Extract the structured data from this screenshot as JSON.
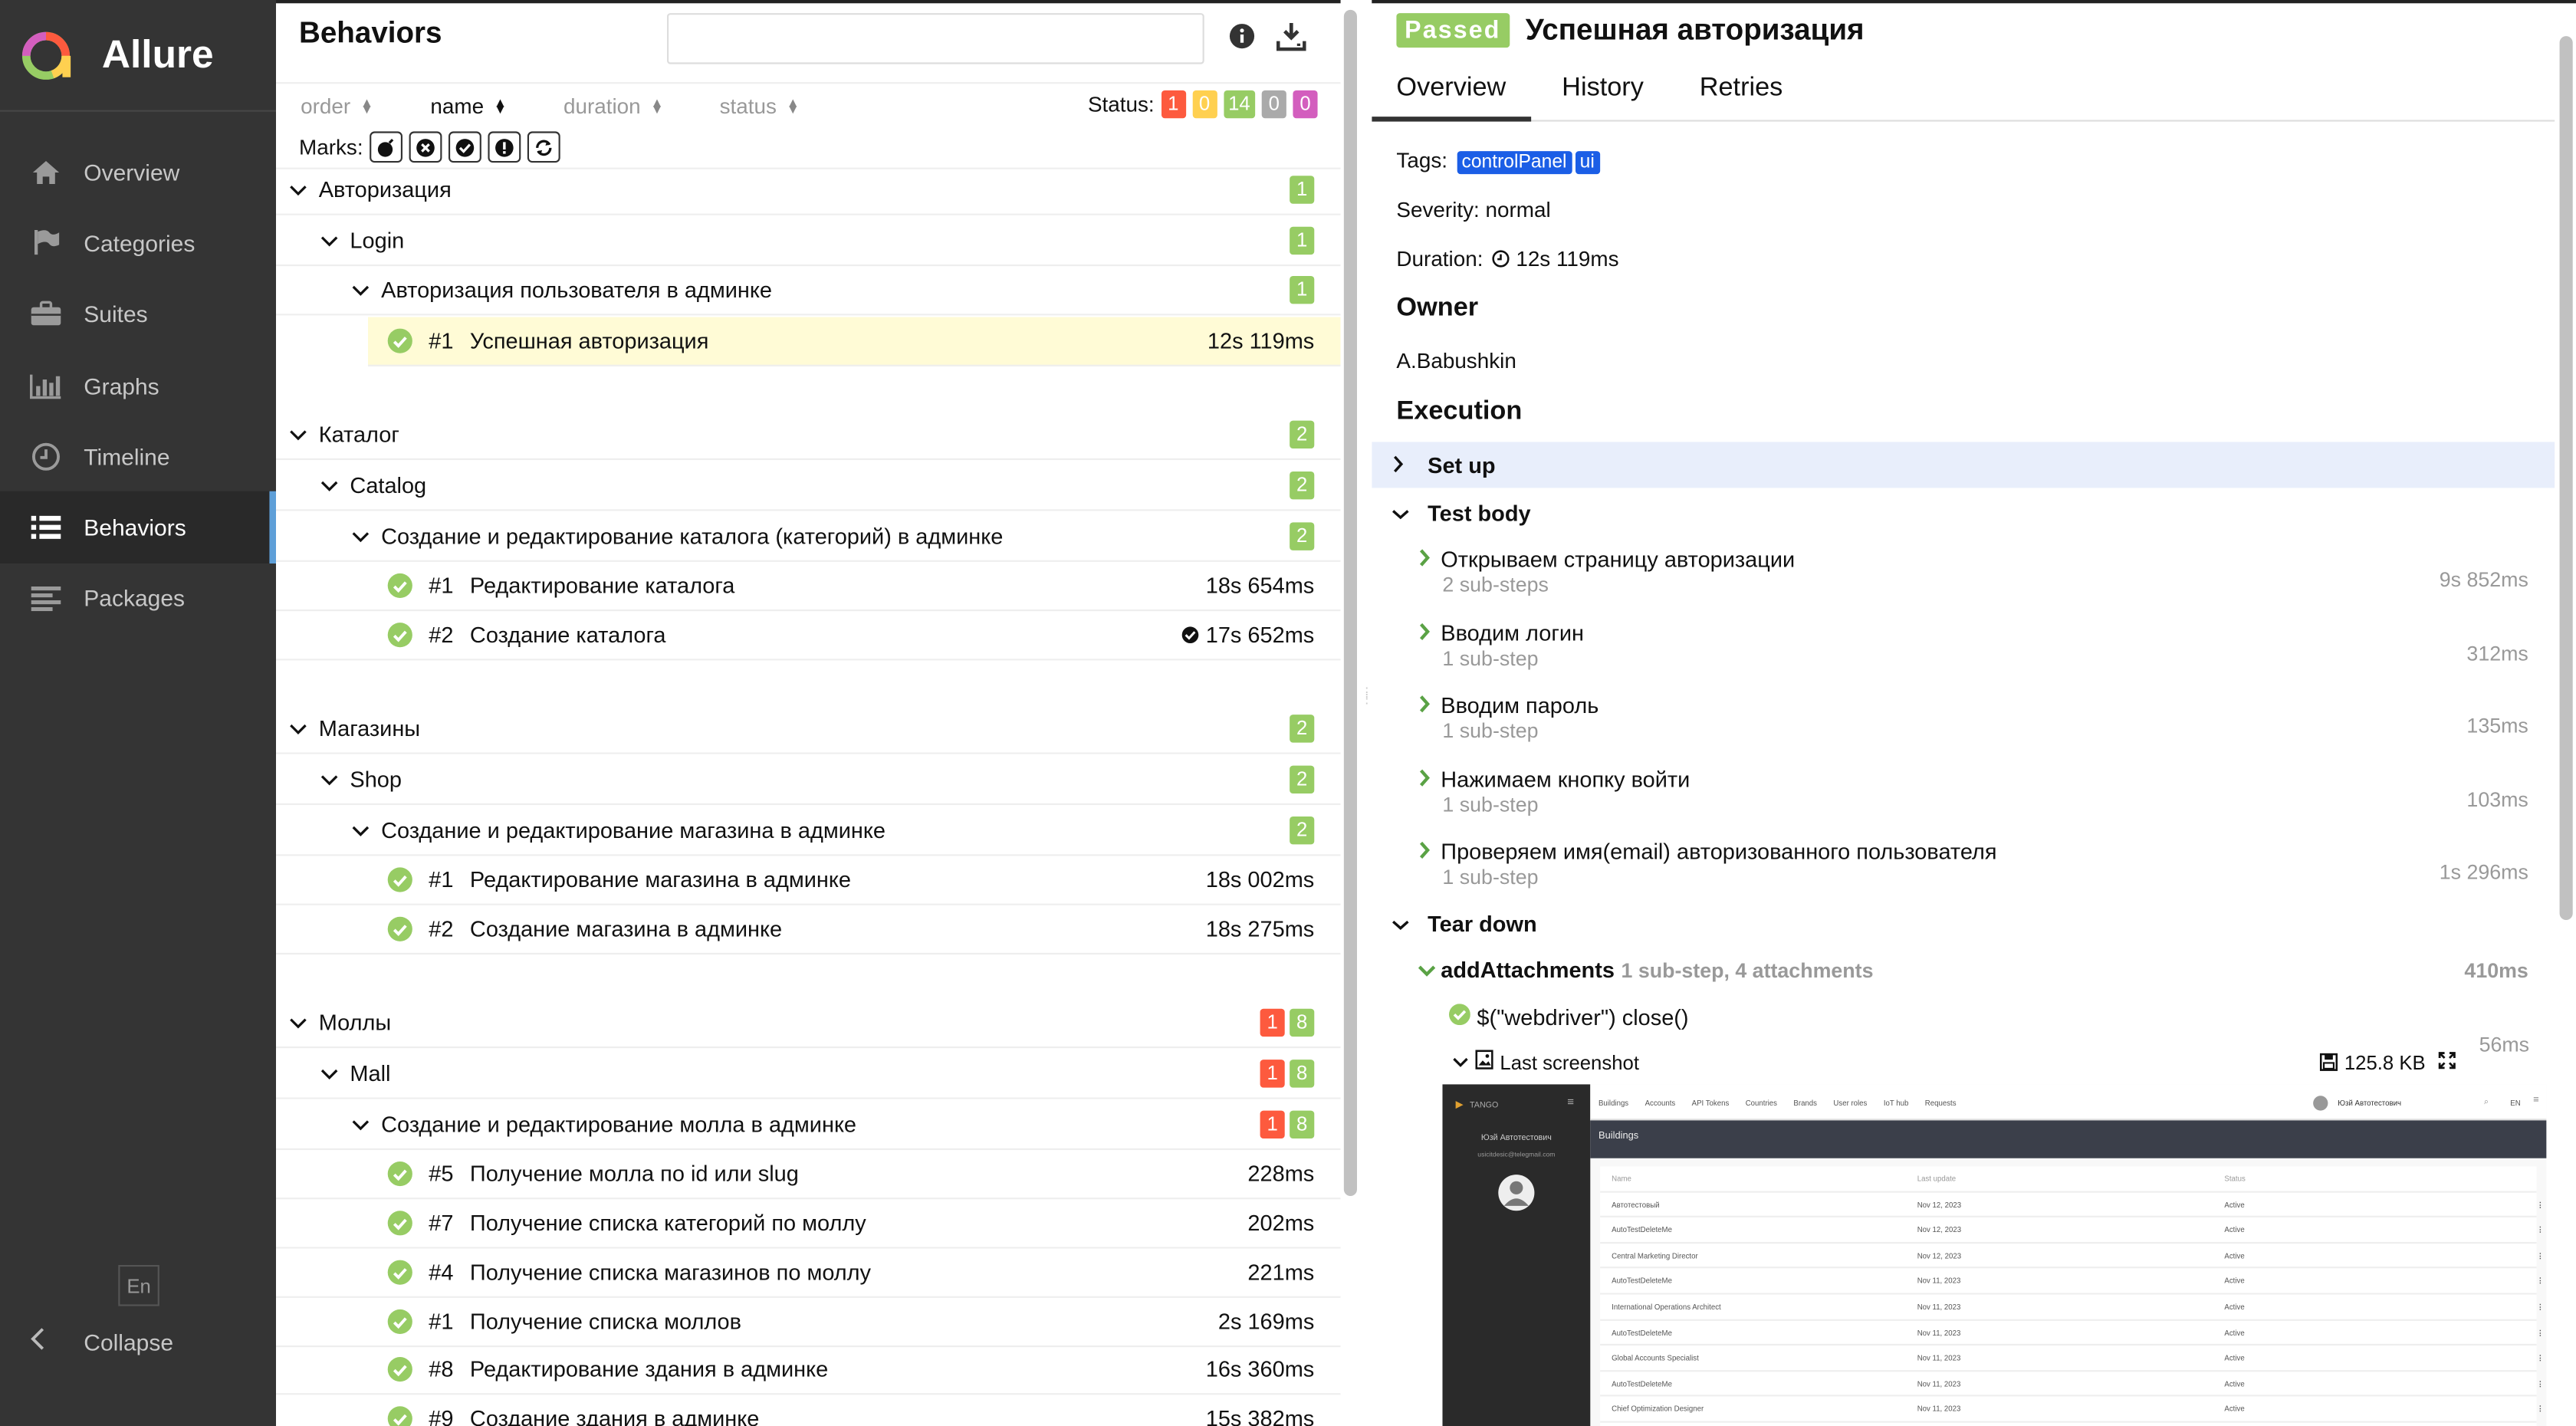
{
  "sidebar": {
    "brand": "Allure",
    "items": [
      {
        "label": "Overview",
        "icon": "home-icon"
      },
      {
        "label": "Categories",
        "icon": "flag-icon"
      },
      {
        "label": "Suites",
        "icon": "briefcase-icon"
      },
      {
        "label": "Graphs",
        "icon": "bar-chart-icon"
      },
      {
        "label": "Timeline",
        "icon": "clock-icon"
      },
      {
        "label": "Behaviors",
        "icon": "list-icon",
        "active": true
      },
      {
        "label": "Packages",
        "icon": "align-left-icon"
      }
    ],
    "lang": "En",
    "collapse": "Collapse"
  },
  "tree": {
    "title": "Behaviors",
    "search_value": "",
    "sort": {
      "order": "order",
      "name": "name",
      "duration": "duration",
      "status": "status"
    },
    "status_label": "Status:",
    "status_counts": [
      "1",
      "0",
      "14",
      "0",
      "0"
    ],
    "marks_label": "Marks:",
    "rows": [
      {
        "level": 0,
        "name": "Авторизация",
        "badges": [
          "1"
        ]
      },
      {
        "level": 1,
        "name": "Login",
        "badges": [
          "1"
        ]
      },
      {
        "level": 2,
        "name": "Авторизация пользователя в админке",
        "badges": [
          "1"
        ]
      },
      {
        "level": 3,
        "num": "#1",
        "name": "Успешная авторизация",
        "dur": "12s 119ms",
        "selected": true
      },
      {
        "level": 0,
        "name": "Каталог",
        "badges": [
          "2"
        ]
      },
      {
        "level": 1,
        "name": "Catalog",
        "badges": [
          "2"
        ]
      },
      {
        "level": 2,
        "name": "Создание и редактирование каталога (категорий) в админке",
        "badges": [
          "2"
        ]
      },
      {
        "level": 3,
        "num": "#1",
        "name": "Редактирование каталога",
        "dur": "18s 654ms"
      },
      {
        "level": 3,
        "num": "#2",
        "name": "Создание каталога",
        "dur": "17s 652ms",
        "mark": true
      },
      {
        "level": 0,
        "name": "Магазины",
        "badges": [
          "2"
        ]
      },
      {
        "level": 1,
        "name": "Shop",
        "badges": [
          "2"
        ]
      },
      {
        "level": 2,
        "name": "Создание и редактирование магазина в админке",
        "badges": [
          "2"
        ]
      },
      {
        "level": 3,
        "num": "#1",
        "name": "Редактирование магазина в админке",
        "dur": "18s 002ms"
      },
      {
        "level": 3,
        "num": "#2",
        "name": "Создание магазина в админке",
        "dur": "18s 275ms"
      },
      {
        "level": 0,
        "name": "Моллы",
        "badges": [
          "1",
          "8"
        ]
      },
      {
        "level": 1,
        "name": "Mall",
        "badges": [
          "1",
          "8"
        ]
      },
      {
        "level": 2,
        "name": "Создание и редактирование молла в админке",
        "badges": [
          "1",
          "8"
        ]
      },
      {
        "level": 3,
        "num": "#5",
        "name": "Получение молла по id или slug",
        "dur": "228ms"
      },
      {
        "level": 3,
        "num": "#7",
        "name": "Получение списка категорий по моллу",
        "dur": "202ms"
      },
      {
        "level": 3,
        "num": "#4",
        "name": "Получение списка магазинов по моллу",
        "dur": "221ms"
      },
      {
        "level": 3,
        "num": "#1",
        "name": "Получение списка моллов",
        "dur": "2s 169ms"
      },
      {
        "level": 3,
        "num": "#8",
        "name": "Редактирование здания в админке",
        "dur": "16s 360ms"
      },
      {
        "level": 3,
        "num": "#9",
        "name": "Создание здания в админке",
        "dur": "15s 382ms"
      }
    ]
  },
  "detail": {
    "status": "Passed",
    "title": "Успешная авторизация",
    "tabs": [
      "Overview",
      "History",
      "Retries"
    ],
    "tags_label": "Tags:",
    "tags": [
      "controlPanel",
      "ui"
    ],
    "severity": "Severity: normal",
    "duration_label": "Duration:",
    "duration": "12s 119ms",
    "owner_heading": "Owner",
    "owner": "A.Babushkin",
    "execution_heading": "Execution",
    "setup": "Set up",
    "test_body": "Test body",
    "steps": [
      {
        "name": "Открываем страницу авторизации",
        "sub": "2 sub-steps",
        "dur": "9s 852ms"
      },
      {
        "name": "Вводим логин",
        "sub": "1 sub-step",
        "dur": "312ms"
      },
      {
        "name": "Вводим пароль",
        "sub": "1 sub-step",
        "dur": "135ms"
      },
      {
        "name": "Нажимаем кнопку войти",
        "sub": "1 sub-step",
        "dur": "103ms"
      },
      {
        "name": "Проверяем имя(email) авторизованного пользователя",
        "sub": "1 sub-step",
        "dur": "1s 296ms"
      }
    ],
    "teardown": "Tear down",
    "attach_step": "addAttachments",
    "attach_meta": "1 sub-step, 4 attachments",
    "attach_dur": "410ms",
    "close_step": "$(\"webdriver\") close()",
    "close_dur": "56ms",
    "screenshot_name": "Last screenshot",
    "screenshot_size": "125.8 KB"
  },
  "screenshot": {
    "logo": "TANGO",
    "menu": [
      "Buildings",
      "Accounts",
      "API Tokens",
      "Countries",
      "Brands",
      "User roles",
      "IoT hub",
      "Requests"
    ],
    "user_name": "Юзй Автотестович",
    "user_email": "usicitdesic@telegmail.com",
    "lang": "EN",
    "page_title": "Buildings",
    "columns": [
      "Name",
      "Last update",
      "Status"
    ],
    "rows": [
      [
        "Автотестовый",
        "Nov 12, 2023",
        "Active"
      ],
      [
        "AutoTestDeleteMe",
        "Nov 12, 2023",
        "Active"
      ],
      [
        "Central Marketing Director",
        "Nov 12, 2023",
        "Active"
      ],
      [
        "AutoTestDeleteMe",
        "Nov 11, 2023",
        "Active"
      ],
      [
        "International Operations Architect",
        "Nov 11, 2023",
        "Active"
      ],
      [
        "AutoTestDeleteMe",
        "Nov 11, 2023",
        "Active"
      ],
      [
        "Global Accounts Specialist",
        "Nov 11, 2023",
        "Active"
      ],
      [
        "AutoTestDeleteMe",
        "Nov 11, 2023",
        "Active"
      ],
      [
        "Chief Optimization Designer",
        "Nov 11, 2023",
        "Active"
      ]
    ]
  },
  "colors": {
    "failed": "#fd5a3e",
    "broken": "#ffd050",
    "passed": "#97cc64",
    "skipped": "#aaaaaa",
    "unknown": "#d35ebe",
    "accent": "#5e9fd8"
  }
}
